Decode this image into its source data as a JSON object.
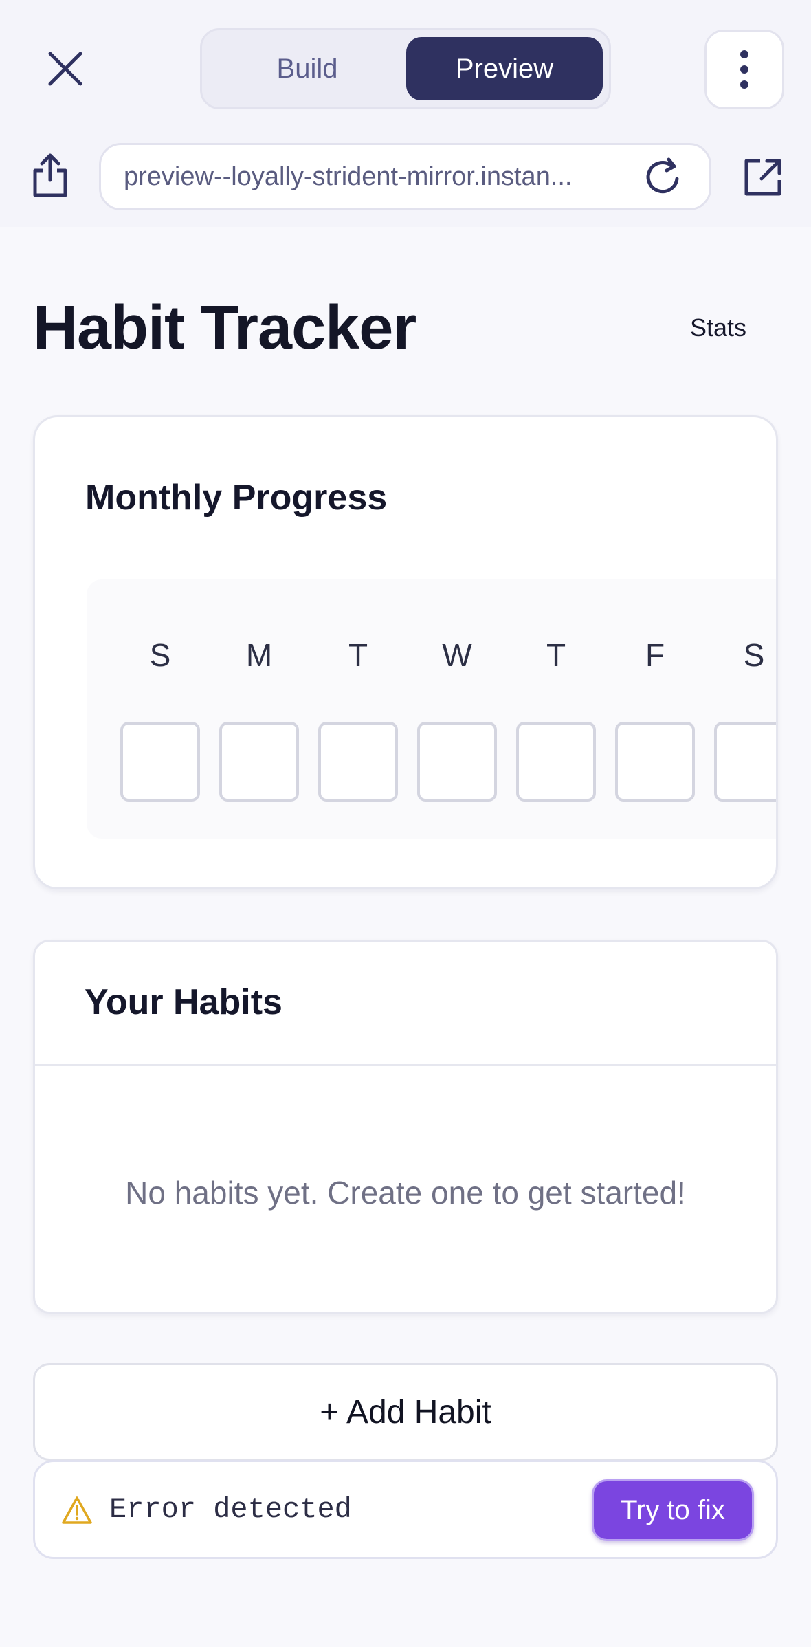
{
  "browser": {
    "tabs": {
      "build": "Build",
      "preview": "Preview",
      "active": "preview"
    },
    "url": "preview--loyally-strident-mirror.instan...",
    "icons": {
      "close": "close-icon",
      "menu": "more-vertical-icon",
      "share": "share-icon",
      "reload": "reload-icon",
      "external": "external-link-icon"
    }
  },
  "page": {
    "title": "Habit Tracker",
    "stats_link": "Stats"
  },
  "monthly_progress": {
    "title": "Monthly Progress",
    "weekdays": [
      "S",
      "M",
      "T",
      "W",
      "T",
      "F",
      "S"
    ]
  },
  "habits": {
    "title": "Your Habits",
    "empty_message": "No habits yet. Create one to get started!"
  },
  "add_habit_label": "+ Add Habit",
  "error_banner": {
    "message": "Error detected",
    "fix_label": "Try to fix",
    "icon": "warning-icon"
  },
  "colors": {
    "accent": "#7b45e0",
    "segment_active": "#2f3160",
    "warning": "#e0a820"
  }
}
